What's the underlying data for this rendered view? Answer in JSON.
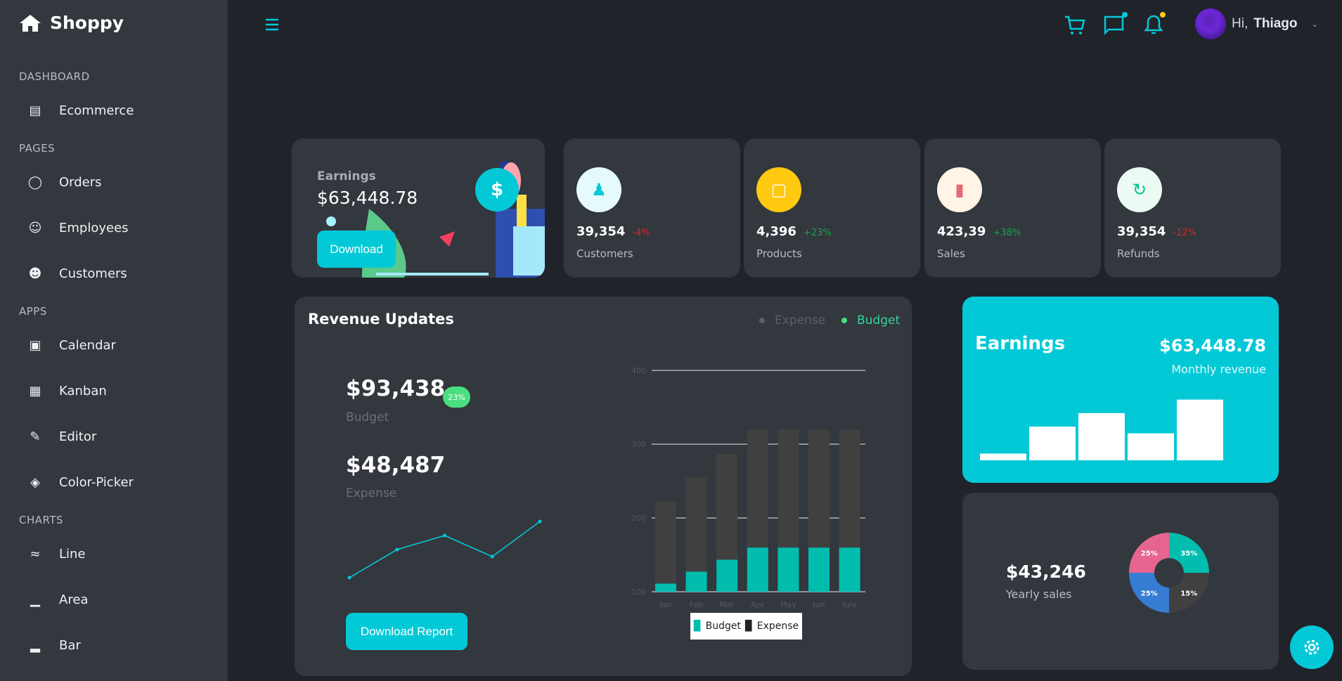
{
  "app": {
    "name": "Shoppy"
  },
  "sidebar": {
    "sections": [
      {
        "title": "DASHBOARD",
        "items": [
          {
            "label": "Ecommerce",
            "icon": "shopping-bag-icon"
          }
        ]
      },
      {
        "title": "PAGES",
        "items": [
          {
            "label": "Orders",
            "icon": "cart-icon"
          },
          {
            "label": "Employees",
            "icon": "people-icon"
          },
          {
            "label": "Customers",
            "icon": "customer-icon"
          }
        ]
      },
      {
        "title": "APPS",
        "items": [
          {
            "label": "Calendar",
            "icon": "calendar-icon"
          },
          {
            "label": "Kanban",
            "icon": "kanban-icon"
          },
          {
            "label": "Editor",
            "icon": "edit-icon"
          },
          {
            "label": "Color-Picker",
            "icon": "color-picker-icon"
          }
        ]
      },
      {
        "title": "CHARTS",
        "items": [
          {
            "label": "Line",
            "icon": "line-chart-icon"
          },
          {
            "label": "Area",
            "icon": "area-chart-icon"
          },
          {
            "label": "Bar",
            "icon": "bar-chart-icon"
          }
        ]
      }
    ]
  },
  "header": {
    "greeting": "Hi,",
    "user": "Thiago",
    "accent": "#03c9d7",
    "chat_dot": "#03c9d7",
    "bell_dot": "#fec90f"
  },
  "earnings_card": {
    "title": "Earnings",
    "amount": "$63,448.78",
    "button": "Download"
  },
  "stats": [
    {
      "value": "39,354",
      "change": "-4%",
      "change_color": "#dc2626",
      "label": "Customers",
      "icon": "users-icon",
      "icon_bg": "#e5fafb",
      "icon_color": "#03c9d7"
    },
    {
      "value": "4,396",
      "change": "+23%",
      "change_color": "#16a34a",
      "label": "Products",
      "icon": "box-icon",
      "icon_bg": "#fec90f",
      "icon_color": "#ffffff"
    },
    {
      "value": "423,39",
      "change": "+38%",
      "change_color": "#16a34a",
      "label": "Sales",
      "icon": "bar-chart-icon",
      "icon_bg": "#fff4e5",
      "icon_color": "#e46a76"
    },
    {
      "value": "39,354",
      "change": "-12%",
      "change_color": "#dc2626",
      "label": "Refunds",
      "icon": "refresh-icon",
      "icon_bg": "#ebfaf2",
      "icon_color": "#00c292"
    }
  ],
  "revenue": {
    "title": "Revenue Updates",
    "legend": [
      "Expense",
      "Budget"
    ],
    "budget_value": "$93,438",
    "budget_badge": "23%",
    "budget_label": "Budget",
    "expense_value": "$48,487",
    "expense_label": "Expense",
    "button": "Download Report",
    "sparkline": {
      "type": "line",
      "x": [
        1,
        2,
        3,
        4,
        5
      ],
      "y": [
        2,
        6,
        8,
        5,
        10
      ],
      "color": "#03c9d7"
    }
  },
  "chart_data": [
    {
      "type": "bar",
      "stacked": true,
      "categories": [
        "Jan",
        "Feb",
        "Mar",
        "Apr",
        "May",
        "Jun",
        "July"
      ],
      "series": [
        {
          "name": "Budget",
          "values": [
            111.1,
            127.3,
            143.4,
            159.9,
            159.9,
            159.9,
            159.9
          ],
          "color": "#00bdae"
        },
        {
          "name": "Expense",
          "values": [
            111.1,
            127.3,
            143.4,
            159.9,
            159.9,
            159.9,
            159.9
          ],
          "color": "#404041"
        }
      ],
      "yticks": [
        100,
        200,
        300,
        400
      ],
      "ylim": [
        100,
        400
      ],
      "grid": true,
      "legend": "bottom"
    },
    {
      "type": "bar",
      "values": [
        2,
        6,
        8,
        5,
        10
      ],
      "color": "#ffffff"
    },
    {
      "type": "pie",
      "donut": true,
      "values": [
        18,
        18,
        18,
        18
      ],
      "labels": [
        "35%",
        "15%",
        "25%",
        "25%"
      ],
      "colors": [
        "#00bdae",
        "#404041",
        "#357cd2",
        "#e56590"
      ]
    }
  ],
  "monthly": {
    "title": "Earnings",
    "amount": "$63,448.78",
    "label": "Monthly revenue"
  },
  "yearly": {
    "amount": "$43,246",
    "label": "Yearly sales"
  }
}
